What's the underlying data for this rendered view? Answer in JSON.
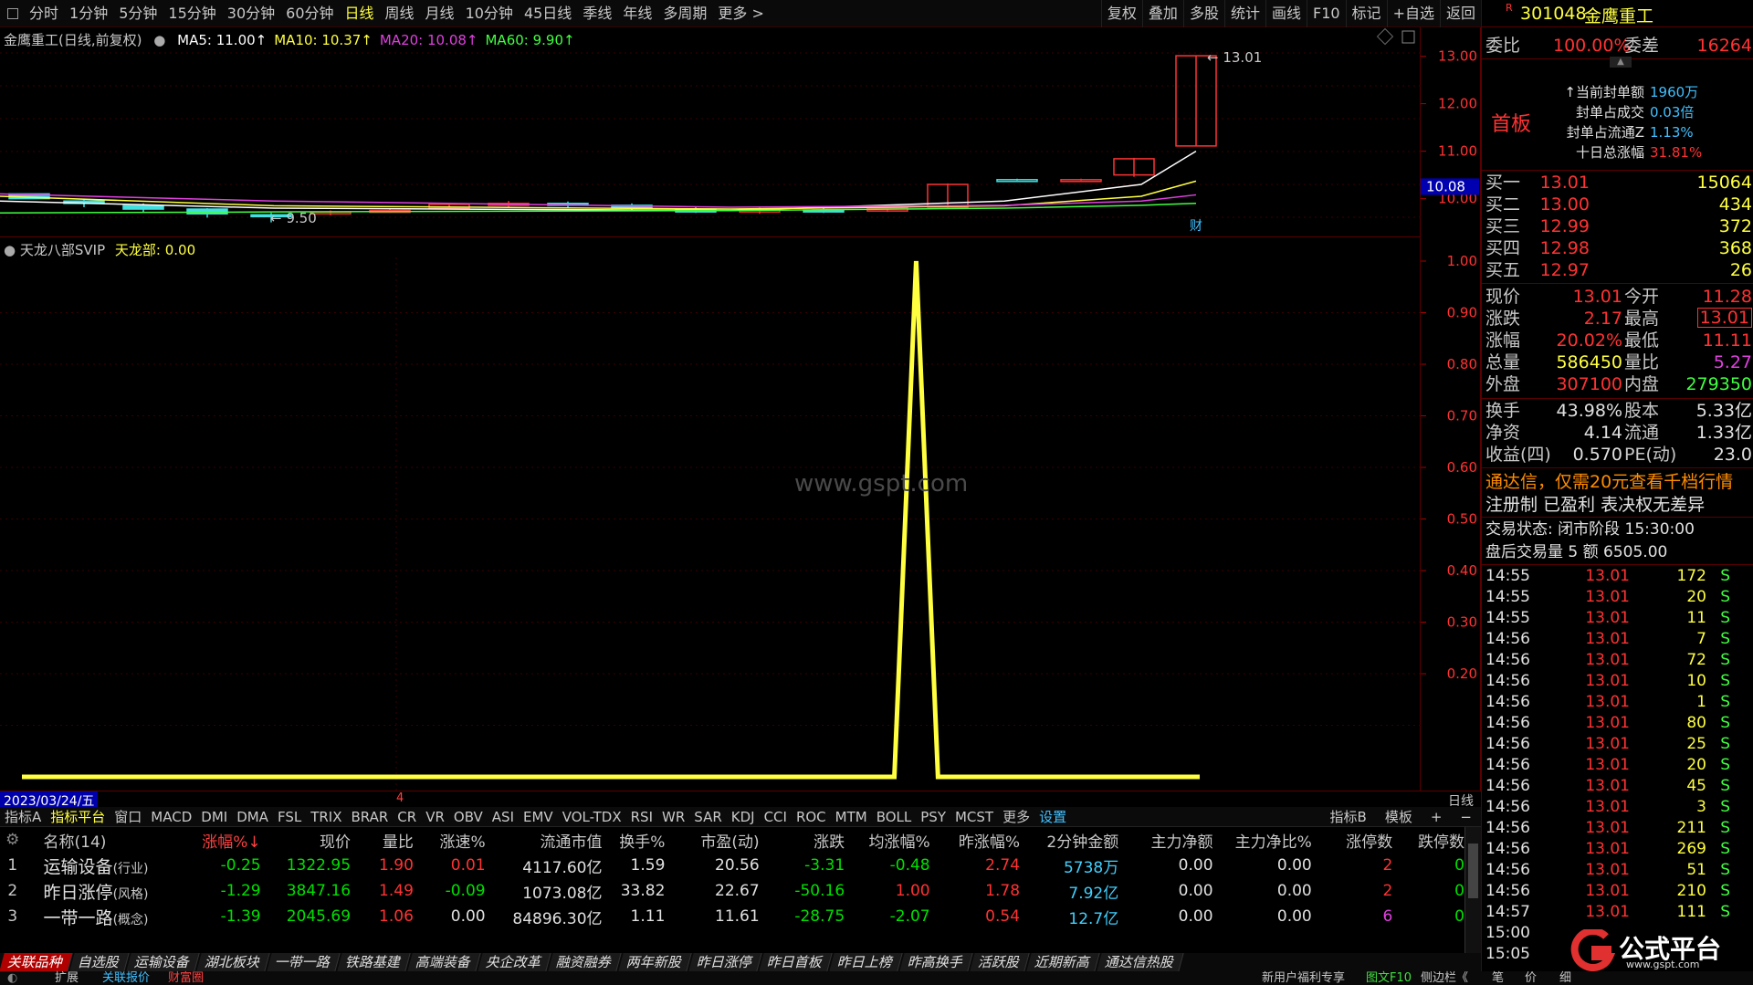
{
  "toolbar": {
    "left": [
      "分时",
      "1分钟",
      "5分钟",
      "15分钟",
      "30分钟",
      "60分钟",
      "日线",
      "周线",
      "月线",
      "10分钟",
      "45日线",
      "季线",
      "年线",
      "多周期",
      "更多 >"
    ],
    "active_index": 6,
    "right": [
      "复权",
      "叠加",
      "多股",
      "统计",
      "画线",
      "F10",
      "标记",
      "+自选",
      "返回"
    ]
  },
  "chart": {
    "title": "金鹰重工(日线,前复权)",
    "ma": [
      {
        "label": "MA5: 11.00↑",
        "color": "#ffffff"
      },
      {
        "label": "MA10: 10.37↑",
        "color": "#ffff40"
      },
      {
        "label": "MA20: 10.08↑",
        "color": "#e040e0"
      },
      {
        "label": "MA60: 9.90↑",
        "color": "#40ff40"
      }
    ],
    "high_label": "13.01",
    "low_label": "9.50",
    "current_price_tag": "10.08",
    "fin_mark": "财",
    "price_axis": [
      "13.00",
      "12.00",
      "11.00",
      "10.00"
    ]
  },
  "indicator": {
    "name": "天龙八部SVIP",
    "value_label": "天龙部: 0.00",
    "axis": [
      "1.00",
      "0.90",
      "0.80",
      "0.70",
      "0.60",
      "0.50",
      "0.40",
      "0.30",
      "0.20"
    ],
    "watermark": "www.gspt.com",
    "series_color": "#ffff40"
  },
  "chart_data": {
    "type": "line",
    "title": "天龙八部SVIP",
    "series": [
      {
        "name": "天龙部",
        "x": [
          0,
          1,
          2,
          3,
          4,
          5,
          6,
          7,
          8,
          9,
          10,
          11,
          12,
          13,
          14,
          15,
          16,
          17,
          18,
          19,
          20,
          21,
          22,
          23,
          24,
          25,
          26,
          27,
          28,
          29,
          30,
          31,
          32,
          33,
          34,
          35,
          36,
          37,
          38,
          39,
          40,
          41,
          42,
          43,
          44,
          45,
          46,
          47,
          48,
          49,
          50,
          51,
          52,
          53,
          54
        ],
        "values": [
          0,
          0,
          0,
          0,
          0,
          0,
          0,
          0,
          0,
          0,
          0,
          0,
          0,
          0,
          0,
          0,
          0,
          0,
          0,
          0,
          0,
          0,
          0,
          0,
          0,
          0,
          0,
          0,
          0,
          0,
          0,
          0,
          0,
          0,
          0,
          0,
          0,
          0,
          0,
          0,
          0,
          1,
          0,
          0,
          0,
          0,
          0,
          0,
          0,
          0,
          0,
          0,
          0,
          0,
          0
        ]
      }
    ],
    "ylim": [
      0,
      1.0
    ],
    "date_marker": "2023/03/24/五",
    "mid_marker": "4",
    "period": "日线"
  },
  "indicator_tabs": {
    "items": [
      "指标A",
      "指标平台",
      "窗口",
      "MACD",
      "DMI",
      "DMA",
      "FSL",
      "TRIX",
      "BRAR",
      "CR",
      "VR",
      "OBV",
      "ASI",
      "EMV",
      "VOL-TDX",
      "RSI",
      "WR",
      "SAR",
      "KDJ",
      "CCI",
      "ROC",
      "MTM",
      "BOLL",
      "PSY",
      "MCST",
      "更多",
      "设置"
    ],
    "selected": "指标平台",
    "right": [
      "指标B",
      "模板",
      "+",
      "−"
    ]
  },
  "table": {
    "columns": [
      "名称(14)",
      "涨幅%↓",
      "现价",
      "量比",
      "涨速%",
      "流通市值",
      "换手%",
      "市盈(动)",
      "涨跌",
      "均涨幅%",
      "昨涨幅%",
      "2分钟金额",
      "主力净额",
      "主力净比%",
      "涨停数",
      "跌停数"
    ],
    "rows": [
      {
        "idx": "1",
        "name": "运输设备",
        "tag": "(行业)",
        "chg": "-0.25",
        "price": "1322.95",
        "vol_ratio": "1.90",
        "speed": "0.01",
        "float_mv": "4117.60亿",
        "turnover": "1.59",
        "pe": "20.56",
        "diff": "-3.31",
        "avg_chg": "-0.48",
        "prev_chg": "2.74",
        "amt2": "5738万",
        "net": "0.00",
        "net_ratio": "0.00",
        "up_cnt": "2",
        "down_cnt": "0"
      },
      {
        "idx": "2",
        "name": "昨日涨停",
        "tag": "(风格)",
        "chg": "-1.29",
        "price": "3847.16",
        "vol_ratio": "1.49",
        "speed": "-0.09",
        "float_mv": "1073.08亿",
        "turnover": "33.82",
        "pe": "22.67",
        "diff": "-50.16",
        "avg_chg": "1.00",
        "prev_chg": "1.78",
        "amt2": "7.92亿",
        "net": "0.00",
        "net_ratio": "0.00",
        "up_cnt": "2",
        "down_cnt": "0"
      },
      {
        "idx": "3",
        "name": "一带一路",
        "tag": "(概念)",
        "chg": "-1.39",
        "price": "2045.69",
        "vol_ratio": "1.06",
        "speed": "0.00",
        "float_mv": "84896.30亿",
        "turnover": "1.11",
        "pe": "11.61",
        "diff": "-28.75",
        "avg_chg": "-2.07",
        "prev_chg": "0.54",
        "amt2": "12.7亿",
        "net": "0.00",
        "net_ratio": "0.00",
        "up_cnt": "6",
        "down_cnt": "0"
      }
    ]
  },
  "bottom_tabs": [
    "关联品种",
    "自选股",
    "运输设备",
    "湖北板块",
    "一带一路",
    "铁路基建",
    "高端装备",
    "央企改革",
    "融资融券",
    "两年新股",
    "昨日涨停",
    "昨日首板",
    "昨日上榜",
    "昨高换手",
    "活跃股",
    "近期新高",
    "通达信热股"
  ],
  "status_bar": {
    "left1": "扩展",
    "left2": "关联报价",
    "left3": "财富圈",
    "right1": "新用户福利专享",
    "right2": "图文F10",
    "right3": "侧边栏《",
    "right4": "笔",
    "right5": "价",
    "right6": "细"
  },
  "right_panel": {
    "code": "301048",
    "name": "金鹰重工",
    "r_mark": "R",
    "weibi_label": "委比",
    "weibi_val": "100.00%",
    "weicha_label": "委差",
    "weicha_val": "16264",
    "board_tag": "首板",
    "seal": [
      {
        "label": "↑当前封单额",
        "val": "1960万"
      },
      {
        "label": "封单占成交",
        "val": "0.03倍"
      },
      {
        "label": "封单占流通Z",
        "val": "1.13%"
      },
      {
        "label": "十日总涨幅",
        "val": "31.81%"
      }
    ],
    "bids": [
      {
        "label": "买一",
        "price": "13.01",
        "vol": "15064"
      },
      {
        "label": "买二",
        "price": "13.00",
        "vol": "434"
      },
      {
        "label": "买三",
        "price": "12.99",
        "vol": "372"
      },
      {
        "label": "买四",
        "price": "12.98",
        "vol": "368"
      },
      {
        "label": "买五",
        "price": "12.97",
        "vol": "26"
      }
    ],
    "quote": [
      {
        "l1": "现价",
        "v1": "13.01",
        "l2": "今开",
        "v2": "11.28"
      },
      {
        "l1": "涨跌",
        "v1": "2.17",
        "l2": "最高",
        "v2": "13.01"
      },
      {
        "l1": "涨幅",
        "v1": "20.02%",
        "l2": "最低",
        "v2": "11.11"
      },
      {
        "l1": "总量",
        "v1": "586450",
        "l2": "量比",
        "v2": "5.27"
      },
      {
        "l1": "外盘",
        "v1": "307100",
        "l2": "内盘",
        "v2": "279350"
      }
    ],
    "fund": [
      {
        "l1": "换手",
        "v1": "43.98%",
        "l2": "股本",
        "v2": "5.33亿"
      },
      {
        "l1": "净资",
        "v1": "4.14",
        "l2": "流通",
        "v2": "1.33亿"
      },
      {
        "l1": "收益(四)",
        "v1": "0.570",
        "l2": "PE(动)",
        "v2": "23.0"
      }
    ],
    "notice1": "通达信，仅需20元查看千档行情",
    "notice2": "注册制 已盈利 表决权无差异",
    "trade_state": "交易状态: 闭市阶段 15:30:00",
    "after_hours": "盘后交易量 5 额 6505.00",
    "ticks": [
      {
        "t": "14:55",
        "p": "13.01",
        "v": "172",
        "s": "S"
      },
      {
        "t": "14:55",
        "p": "13.01",
        "v": "20",
        "s": "S"
      },
      {
        "t": "14:55",
        "p": "13.01",
        "v": "11",
        "s": "S"
      },
      {
        "t": "14:56",
        "p": "13.01",
        "v": "7",
        "s": "S"
      },
      {
        "t": "14:56",
        "p": "13.01",
        "v": "72",
        "s": "S"
      },
      {
        "t": "14:56",
        "p": "13.01",
        "v": "10",
        "s": "S"
      },
      {
        "t": "14:56",
        "p": "13.01",
        "v": "1",
        "s": "S"
      },
      {
        "t": "14:56",
        "p": "13.01",
        "v": "80",
        "s": "S"
      },
      {
        "t": "14:56",
        "p": "13.01",
        "v": "25",
        "s": "S"
      },
      {
        "t": "14:56",
        "p": "13.01",
        "v": "20",
        "s": "S"
      },
      {
        "t": "14:56",
        "p": "13.01",
        "v": "45",
        "s": "S"
      },
      {
        "t": "14:56",
        "p": "13.01",
        "v": "3",
        "s": "S"
      },
      {
        "t": "14:56",
        "p": "13.01",
        "v": "211",
        "s": "S"
      },
      {
        "t": "14:56",
        "p": "13.01",
        "v": "269",
        "s": "S"
      },
      {
        "t": "14:56",
        "p": "13.01",
        "v": "51",
        "s": "S"
      },
      {
        "t": "14:56",
        "p": "13.01",
        "v": "210",
        "s": "S"
      },
      {
        "t": "14:57",
        "p": "13.01",
        "v": "111",
        "s": "S"
      },
      {
        "t": "15:00",
        "p": "",
        "v": "",
        "s": ""
      },
      {
        "t": "15:05",
        "p": "",
        "v": "",
        "s": ""
      }
    ]
  },
  "logo": {
    "text": "公式平台",
    "url_text": "www.gspt.com"
  }
}
